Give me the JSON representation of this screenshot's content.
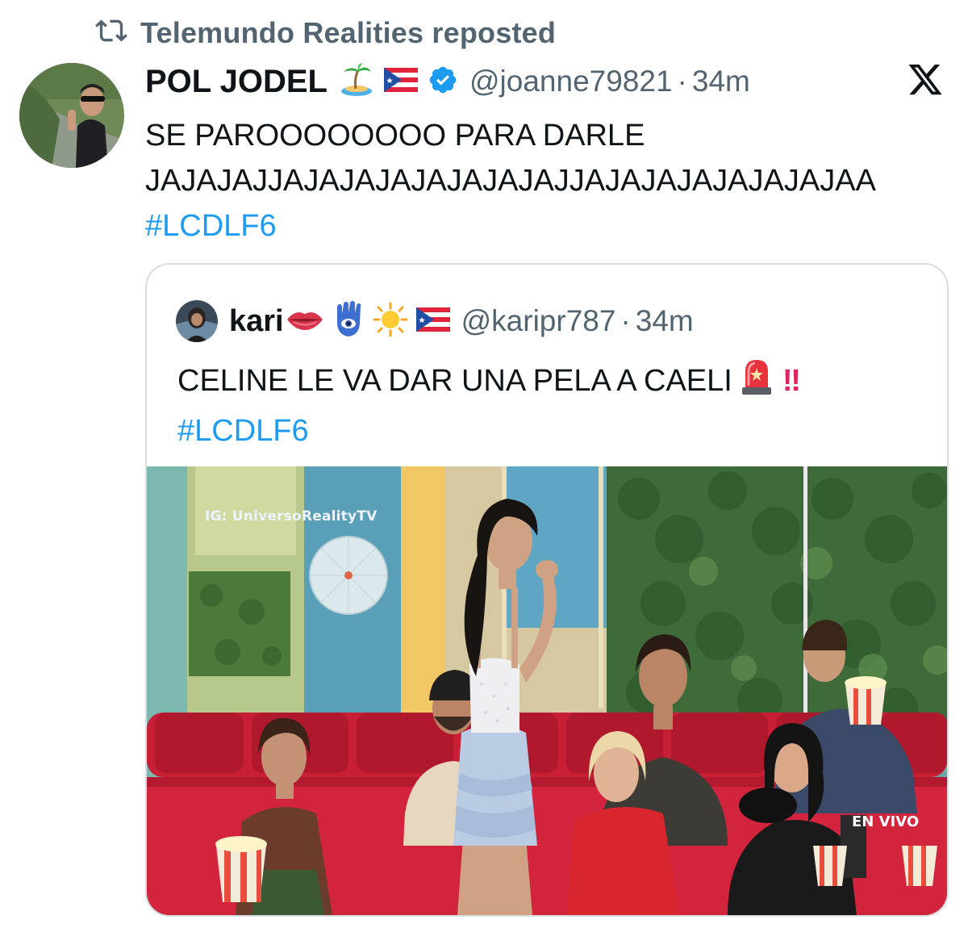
{
  "repost": {
    "icon": "repost-icon",
    "text": "Telemundo Realities reposted"
  },
  "tweet": {
    "author_name": "POL JODEL",
    "name_emojis": [
      "desert-island-emoji",
      "puerto-rico-flag-emoji",
      "verified-badge-icon"
    ],
    "handle": "@joanne79821",
    "separator": "·",
    "time": "34m",
    "line1": "SE PAROOOOOOOO PARA DARLE",
    "line2": "JAJAJAJJAJAJAJAJAJAJAJAJJAJAJAJAJAJAJAJAA",
    "hashtag": "#LCDLF6"
  },
  "x_logo": "x-logo-icon",
  "quote": {
    "author_name": "kari",
    "name_emojis": [
      "lips-emoji",
      "hamsa-emoji",
      "sun-emoji",
      "puerto-rico-flag-emoji"
    ],
    "handle": "@karipr787",
    "separator": "·",
    "time": "34m",
    "text": "CELINE LE VA DAR UNA PELA A CAELI",
    "text_emojis": [
      "police-light-emoji",
      "double-exclamation-emoji"
    ],
    "bangs": "‼",
    "hashtag": "#LCDLF6"
  },
  "media": {
    "watermark": "IG: UniversoRealityTV",
    "live_label": "EN VIVO"
  },
  "colors": {
    "link": "#1d9bf0",
    "secondary_text": "#536471",
    "sofa": "#d21f3c"
  }
}
